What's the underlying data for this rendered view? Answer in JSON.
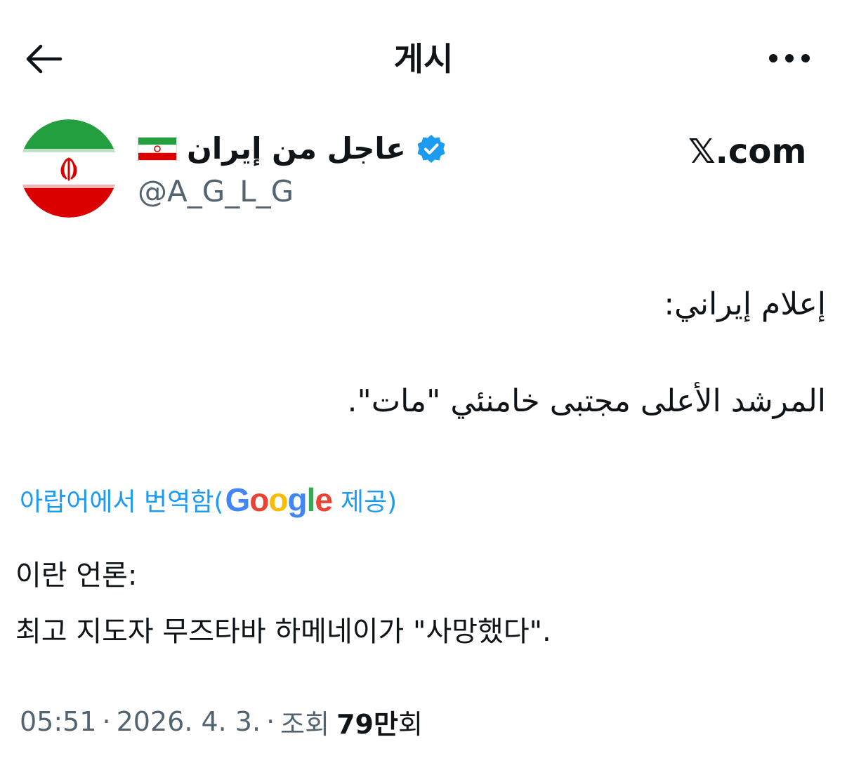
{
  "header": {
    "title": "게시",
    "back_icon": "arrow-left-icon",
    "more_icon": "more-horizontal-icon"
  },
  "author": {
    "name": "عاجل من إيران",
    "flag_icon": "iran-flag-emoji",
    "verified_icon": "verified-badge-icon",
    "verified_color": "#1d9bf0",
    "handle": "@A_G_L_G"
  },
  "watermark": "𝕏.com",
  "post": {
    "original_lines": [
      "إعلام إيراني:",
      "المرشد الأعلى مجتبى خامنئي \"مات\"."
    ],
    "translation_label_prefix": "아랍어에서 번역함(",
    "translation_provider": "Google",
    "translation_label_suffix": " 제공)",
    "translated_lines": [
      "이란 언론:",
      "최고 지도자 무즈타바 하메네이가 \"사망했다\"."
    ]
  },
  "meta": {
    "time": "05:51",
    "separator": "·",
    "date": "2026. 4. 3.",
    "views_label": "조회",
    "views_count": "79만",
    "views_suffix": "회"
  },
  "colors": {
    "text": "#0f1419",
    "secondary": "#536471",
    "link": "#1d9bf0"
  }
}
